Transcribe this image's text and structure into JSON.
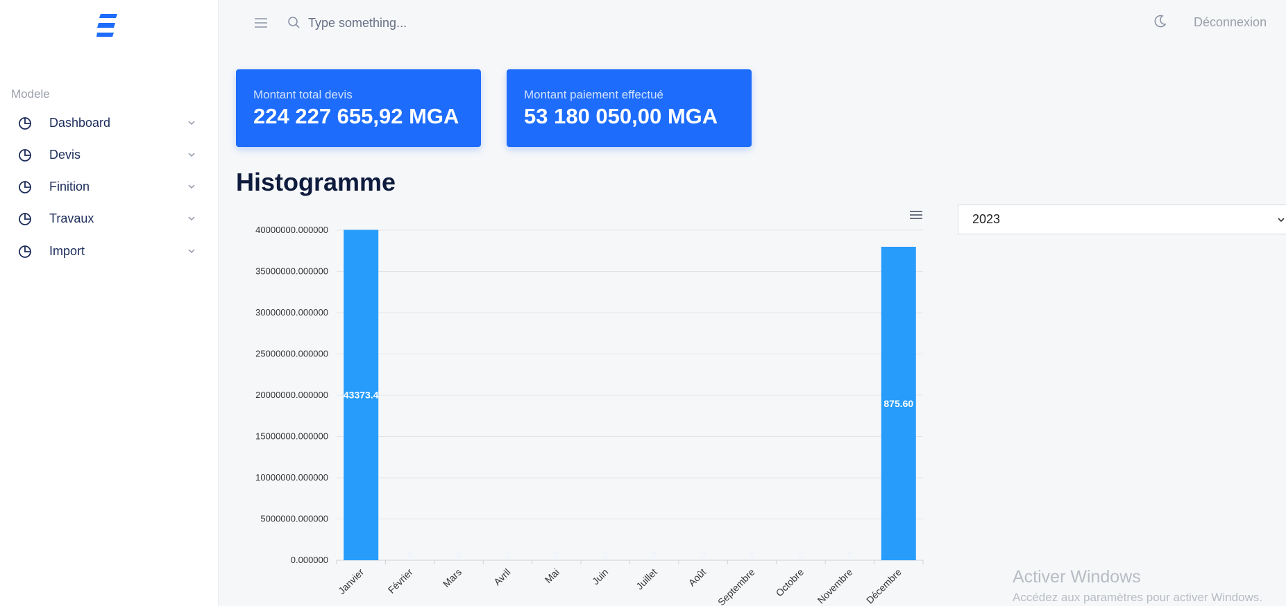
{
  "sidebar": {
    "section": "Modele",
    "items": [
      {
        "label": "Dashboard"
      },
      {
        "label": "Devis"
      },
      {
        "label": "Finition"
      },
      {
        "label": "Travaux"
      },
      {
        "label": "Import"
      }
    ]
  },
  "topbar": {
    "search_placeholder": "Type something...",
    "logout_label": "Déconnexion"
  },
  "cards": [
    {
      "label": "Montant total devis",
      "value": "224 227 655,92 MGA"
    },
    {
      "label": "Montant paiement effectué",
      "value": "53 180 050,00 MGA"
    }
  ],
  "page_title": "Histogramme",
  "year_select": {
    "value": "2023"
  },
  "colors": {
    "accent": "#1d6cfb",
    "bar": "#279cfb",
    "title": "#0f1b3d"
  },
  "chart_data": {
    "type": "bar",
    "categories": [
      "Janvier",
      "Février",
      "Mars",
      "Avril",
      "Mai",
      "Juin",
      "Juillet",
      "Août",
      "Septembre",
      "Octobre",
      "Novembre",
      "Décembre"
    ],
    "values": [
      40043373.4,
      0,
      0,
      0,
      0,
      0,
      0,
      0,
      0,
      0,
      0,
      37986875.6
    ],
    "data_labels": [
      "43373.4",
      "0",
      "0",
      "0",
      "0",
      "0",
      "0",
      "0",
      "0",
      "0",
      "0",
      "875.60"
    ],
    "ylim": [
      0,
      40000000
    ],
    "y_ticks": [
      "0.000000",
      "5000000.000000",
      "10000000.000000",
      "15000000.000000",
      "20000000.000000",
      "25000000.000000",
      "30000000.000000",
      "35000000.000000",
      "40000000.000000"
    ],
    "grid": true
  },
  "watermark": {
    "title": "Activer Windows",
    "subtitle": "Accédez aux paramètres pour activer Windows."
  }
}
